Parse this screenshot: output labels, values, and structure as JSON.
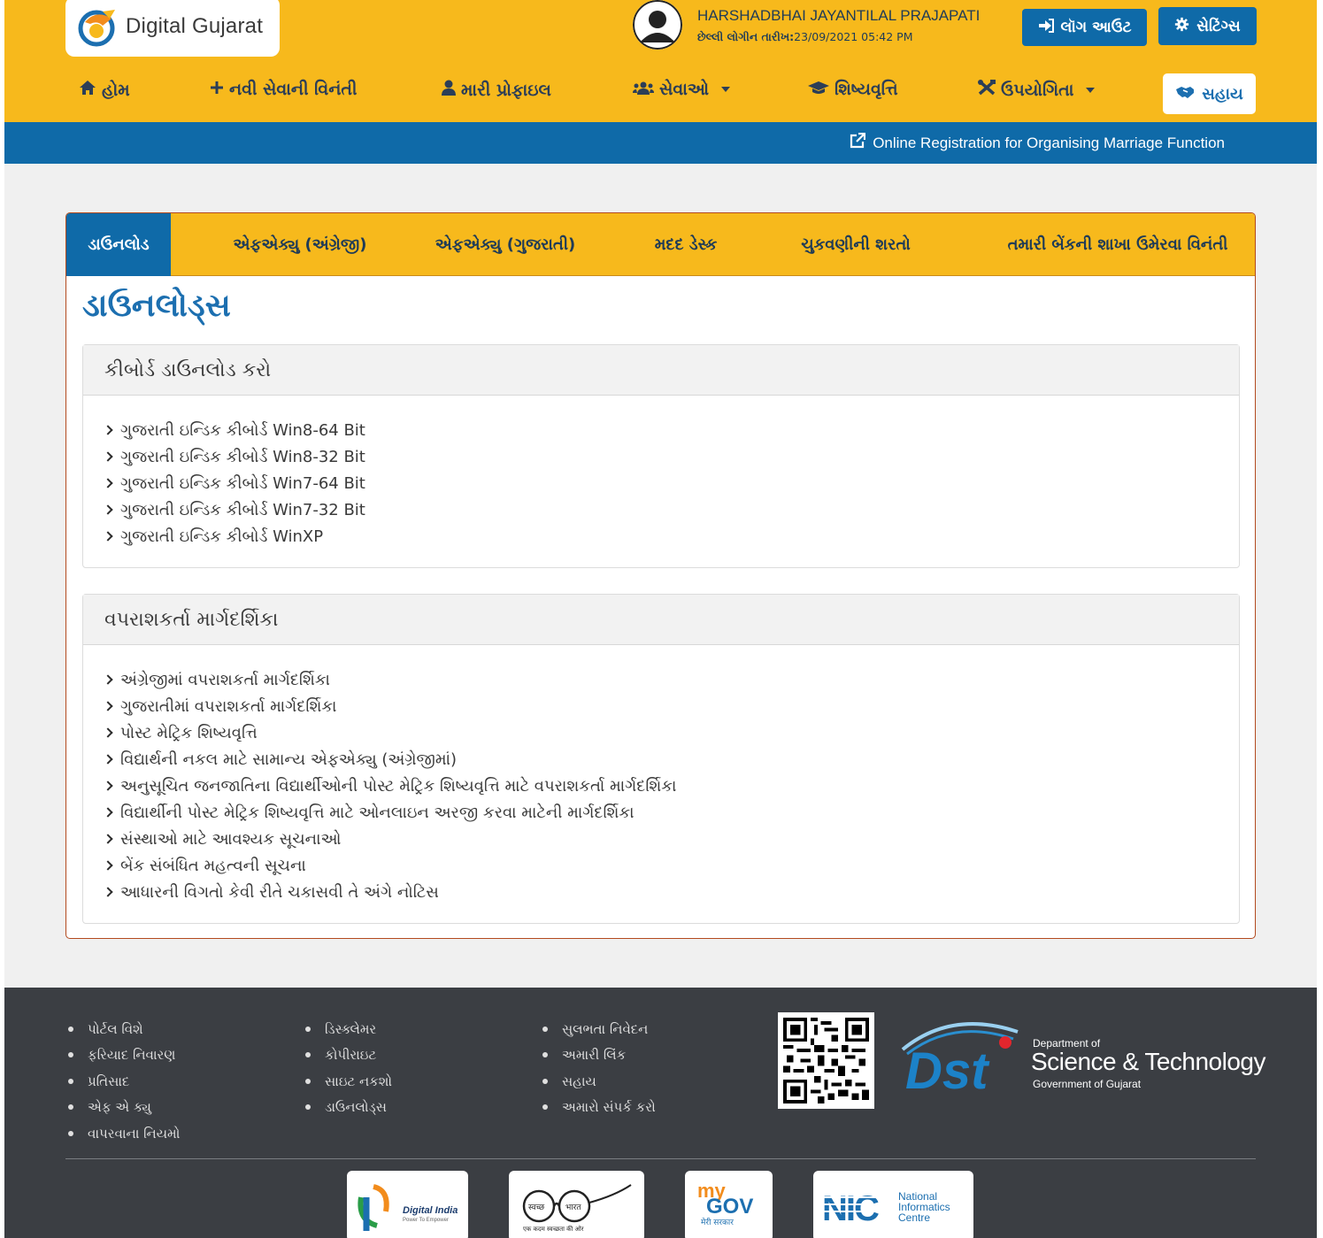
{
  "header": {
    "logo_text": "Digital Gujarat",
    "user_name": "HARSHADBHAI JAYANTILAL PRAJAPATI",
    "last_login_label": "છેલ્લી લોગીન તારીખ:",
    "last_login_value": "23/09/2021 05:42 PM",
    "logout_label": "લૉગ આઉટ",
    "settings_label": "સેટિંગ્સ"
  },
  "nav": {
    "home": "હોમ",
    "new_service": "નવી સેવાની વિનંતી",
    "profile": "મારી પ્રોફાઇલ",
    "services": "સેવાઓ",
    "scholarship": "શિષ્યવૃત્તિ",
    "utility": "ઉપયોગિતા",
    "help": "સહાય"
  },
  "strip": {
    "link_label": "Online Registration for Organising Marriage Function"
  },
  "tabs": [
    "ડાઉનલોડ",
    "એફએક્યુ (અંગ્રેજી)",
    "એફએક્યુ (ગુજરાતી)",
    "મદદ ડેસ્ક",
    "ચુકવણીની શરતો",
    "તમારી બેંકની શાખા ઉમેરવા વિનંતી"
  ],
  "page_title": "ડાઉનલોડ્સ",
  "keyboard_panel": {
    "title": "કીબોર્ડ ડાઉનલોડ કરો",
    "items": [
      "ગુજરાતી ઇન્ડિક કીબોર્ડ Win8-64 Bit",
      "ગુજરાતી ઇન્ડિક કીબોર્ડ Win8-32 Bit",
      "ગુજરાતી ઇન્ડિક કીબોર્ડ Win7-64 Bit",
      "ગુજરાતી ઇન્ડિક કીબોર્ડ Win7-32 Bit",
      "ગુજરાતી ઇન્ડિક કીબોર્ડ WinXP"
    ]
  },
  "guide_panel": {
    "title": "વપરાશકર્તા માર્ગદર્શિકા",
    "items": [
      "અંગ્રેજીમાં વપરાશકર્તા માર્ગદર્શિકા",
      "ગુજરાતીમાં વપરાશકર્તા માર્ગદર્શિકા",
      "પોસ્ટ મેટ્રિક શિષ્યવૃત્તિ",
      "વિદ્યાર્થની નકલ માટે સામાન્ય એફએક્યુ (અંગ્રેજીમાં)",
      "અનુસૂચિત જનજાતિના વિદ્યાર્થીઓની પોસ્ટ મેટ્રિક શિષ્યવૃત્તિ માટે વપરાશકર્તા માર્ગદર્શિકા",
      "વિદ્યાર્થીની પોસ્ટ મેટ્રિક શિષ્યવૃત્તિ માટે ઓનલાઇન અરજી કરવા માટેની માર્ગદર્શિકા",
      "સંસ્થાઓ માટે આવશ્યક સૂચનાઓ",
      "બેંક સંબંધિત મહત્વની સૂચના",
      "આધારની વિગતો કેવી રીતે ચકાસવી તે અંગે નોટિસ"
    ]
  },
  "footer": {
    "col1": [
      "પોર્ટલ વિશે",
      "ફરિયાદ નિવારણ",
      "પ્રતિસાદ",
      "એફ એ ક્યુ",
      "વાપરવાના નિયમો"
    ],
    "col2": [
      "ડિસ્ક્લેમર",
      "કોપીરાઇટ",
      "સાઇટ નકશો",
      "ડાઉનલોડ્સ"
    ],
    "col3": [
      "સુલભતા નિવેદન",
      "અમારી લિંક",
      "સહાય",
      "અમારો સંપર્ક કરો"
    ],
    "dst_dept": "Department of",
    "dst_name": "Science & Technology",
    "dst_gov": "Government of Gujarat",
    "dst_logo_letters": "Dst",
    "partners": {
      "digital_india": "Digital India",
      "digital_india_tag": "Power To Empower",
      "swachh_left": "स्वच्छ",
      "swachh_right": "भारत",
      "swachh_tag": "एक कदम स्वच्छता की ओर",
      "mygov_my": "my",
      "mygov_gov": "GOV",
      "mygov_tag": "मेरी सरकार",
      "nic_logo": "NIC",
      "nic_line1": "National",
      "nic_line2": "Informatics",
      "nic_line3": "Centre"
    }
  }
}
